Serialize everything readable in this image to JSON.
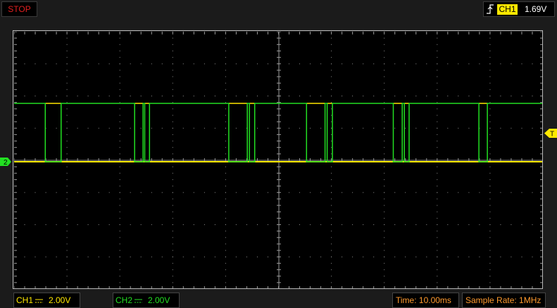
{
  "toolbar": {
    "run_state": "STOP"
  },
  "trigger": {
    "source": "CH1",
    "level": "1.69V",
    "slope": "rising-edge-icon",
    "marker": "T",
    "color": "#ffe800"
  },
  "channels": {
    "ch1": {
      "label": "CH1",
      "scale": "2.00V",
      "coupling": "dc-coupling-icon",
      "color": "#ffe800"
    },
    "ch2": {
      "label": "CH2",
      "scale": "2.00V",
      "coupling": "dc-coupling-icon",
      "color": "#22e022",
      "marker": "2"
    }
  },
  "timebase": {
    "label": "Time: 10.00ms"
  },
  "acquisition": {
    "label": "Sample Rate: 1MHz"
  },
  "colors": {
    "background": "#000000",
    "grid_dots": "#8c8c8c",
    "frame": "#b8b8b8"
  },
  "waveforms": {
    "ch2_high_intervals": [
      [
        0,
        0.59
      ],
      [
        0.89,
        2.28
      ],
      [
        2.44,
        2.47
      ],
      [
        2.56,
        4.06
      ],
      [
        4.41,
        4.45
      ],
      [
        4.55,
        5.53
      ],
      [
        5.88,
        5.92
      ],
      [
        6.02,
        7.17
      ],
      [
        7.34,
        7.38
      ],
      [
        7.47,
        8.79
      ],
      [
        8.95,
        10
      ]
    ],
    "ch2_low_intervals": [
      [
        0.59,
        0.89
      ],
      [
        2.28,
        2.44
      ],
      [
        2.47,
        2.56
      ],
      [
        4.06,
        4.41
      ],
      [
        4.45,
        4.55
      ],
      [
        5.53,
        5.88
      ],
      [
        5.92,
        6.02
      ],
      [
        7.17,
        7.34
      ],
      [
        7.38,
        7.47
      ],
      [
        8.79,
        8.95
      ]
    ]
  }
}
